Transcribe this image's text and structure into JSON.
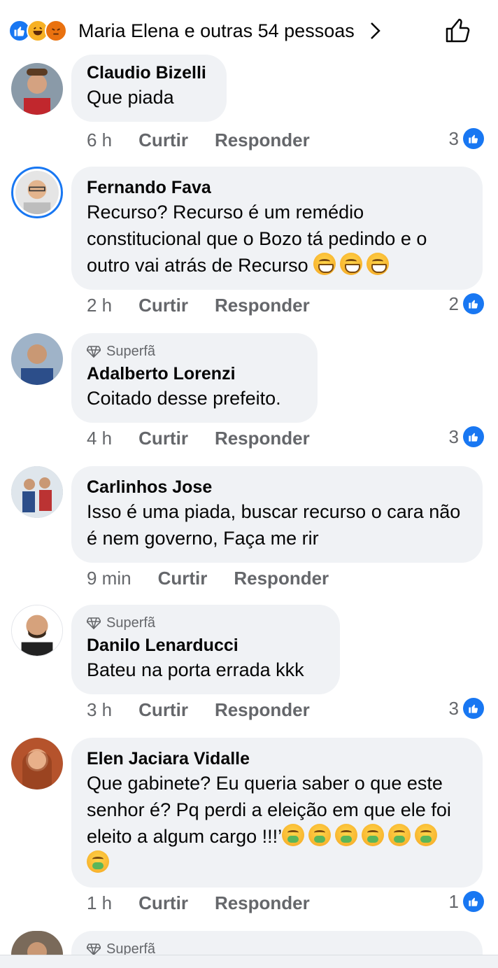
{
  "header": {
    "reactions": [
      "like-icon",
      "haha-icon",
      "angry-icon"
    ],
    "title": "Maria Elena e outras 54 pessoas"
  },
  "actions": {
    "like": "Curtir",
    "reply": "Responder"
  },
  "badge_label": "Superfã",
  "comments": [
    {
      "name": "Claudio Bizelli",
      "text": "Que piada",
      "time": "6 h",
      "likes": "3"
    },
    {
      "name": "Fernando Fava",
      "text": "Recurso? Recurso é um remédio constitucional que o Bozo tá pedindo e o outro vai atrás de Recurso",
      "time": "2 h",
      "likes": "2"
    },
    {
      "name": "Adalberto Lorenzi",
      "text": "Coitado desse prefeito.",
      "time": "4 h",
      "likes": "3",
      "badge": true
    },
    {
      "name": "Carlinhos Jose",
      "text": "Isso é uma piada, buscar recurso o cara não é nem governo, Faça me rir",
      "time": "9 min",
      "likes": ""
    },
    {
      "name": "Danilo Lenarducci",
      "text": "Bateu na porta errada kkk",
      "time": "3 h",
      "likes": "3",
      "badge": true
    },
    {
      "name": "Elen Jaciara Vidalle",
      "text": "Que gabinete? Eu queria saber o que este senhor é? Pq perdi a eleição em que ele foi eleito a algum cargo !!!’",
      "time": "1 h",
      "likes": "1"
    }
  ],
  "colors": {
    "accent": "#1877f2",
    "bubble": "#f0f2f5",
    "meta": "#65676b"
  }
}
